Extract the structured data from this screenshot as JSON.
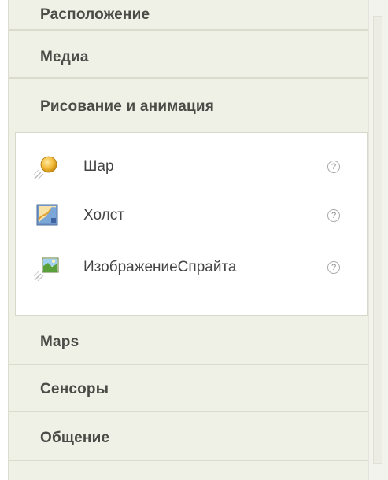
{
  "palette": {
    "drawers": {
      "layout": "Расположение",
      "media": "Медиа",
      "drawing": "Рисование и анимация",
      "maps": "Maps",
      "sensors": "Сенсоры",
      "social": "Общение"
    },
    "drawing_components": [
      {
        "label": "Шар",
        "icon": "ball-icon",
        "help": "?"
      },
      {
        "label": "Холст",
        "icon": "canvas-icon",
        "help": "?"
      },
      {
        "label": "ИзображениеСпрайта",
        "icon": "image-sprite-icon",
        "help": "?"
      }
    ]
  },
  "colors": {
    "panel_bg": "#f0f1e6",
    "drawer_border": "#dadacd",
    "header_text": "#4b4b47",
    "content_bg": "#ffffff"
  }
}
